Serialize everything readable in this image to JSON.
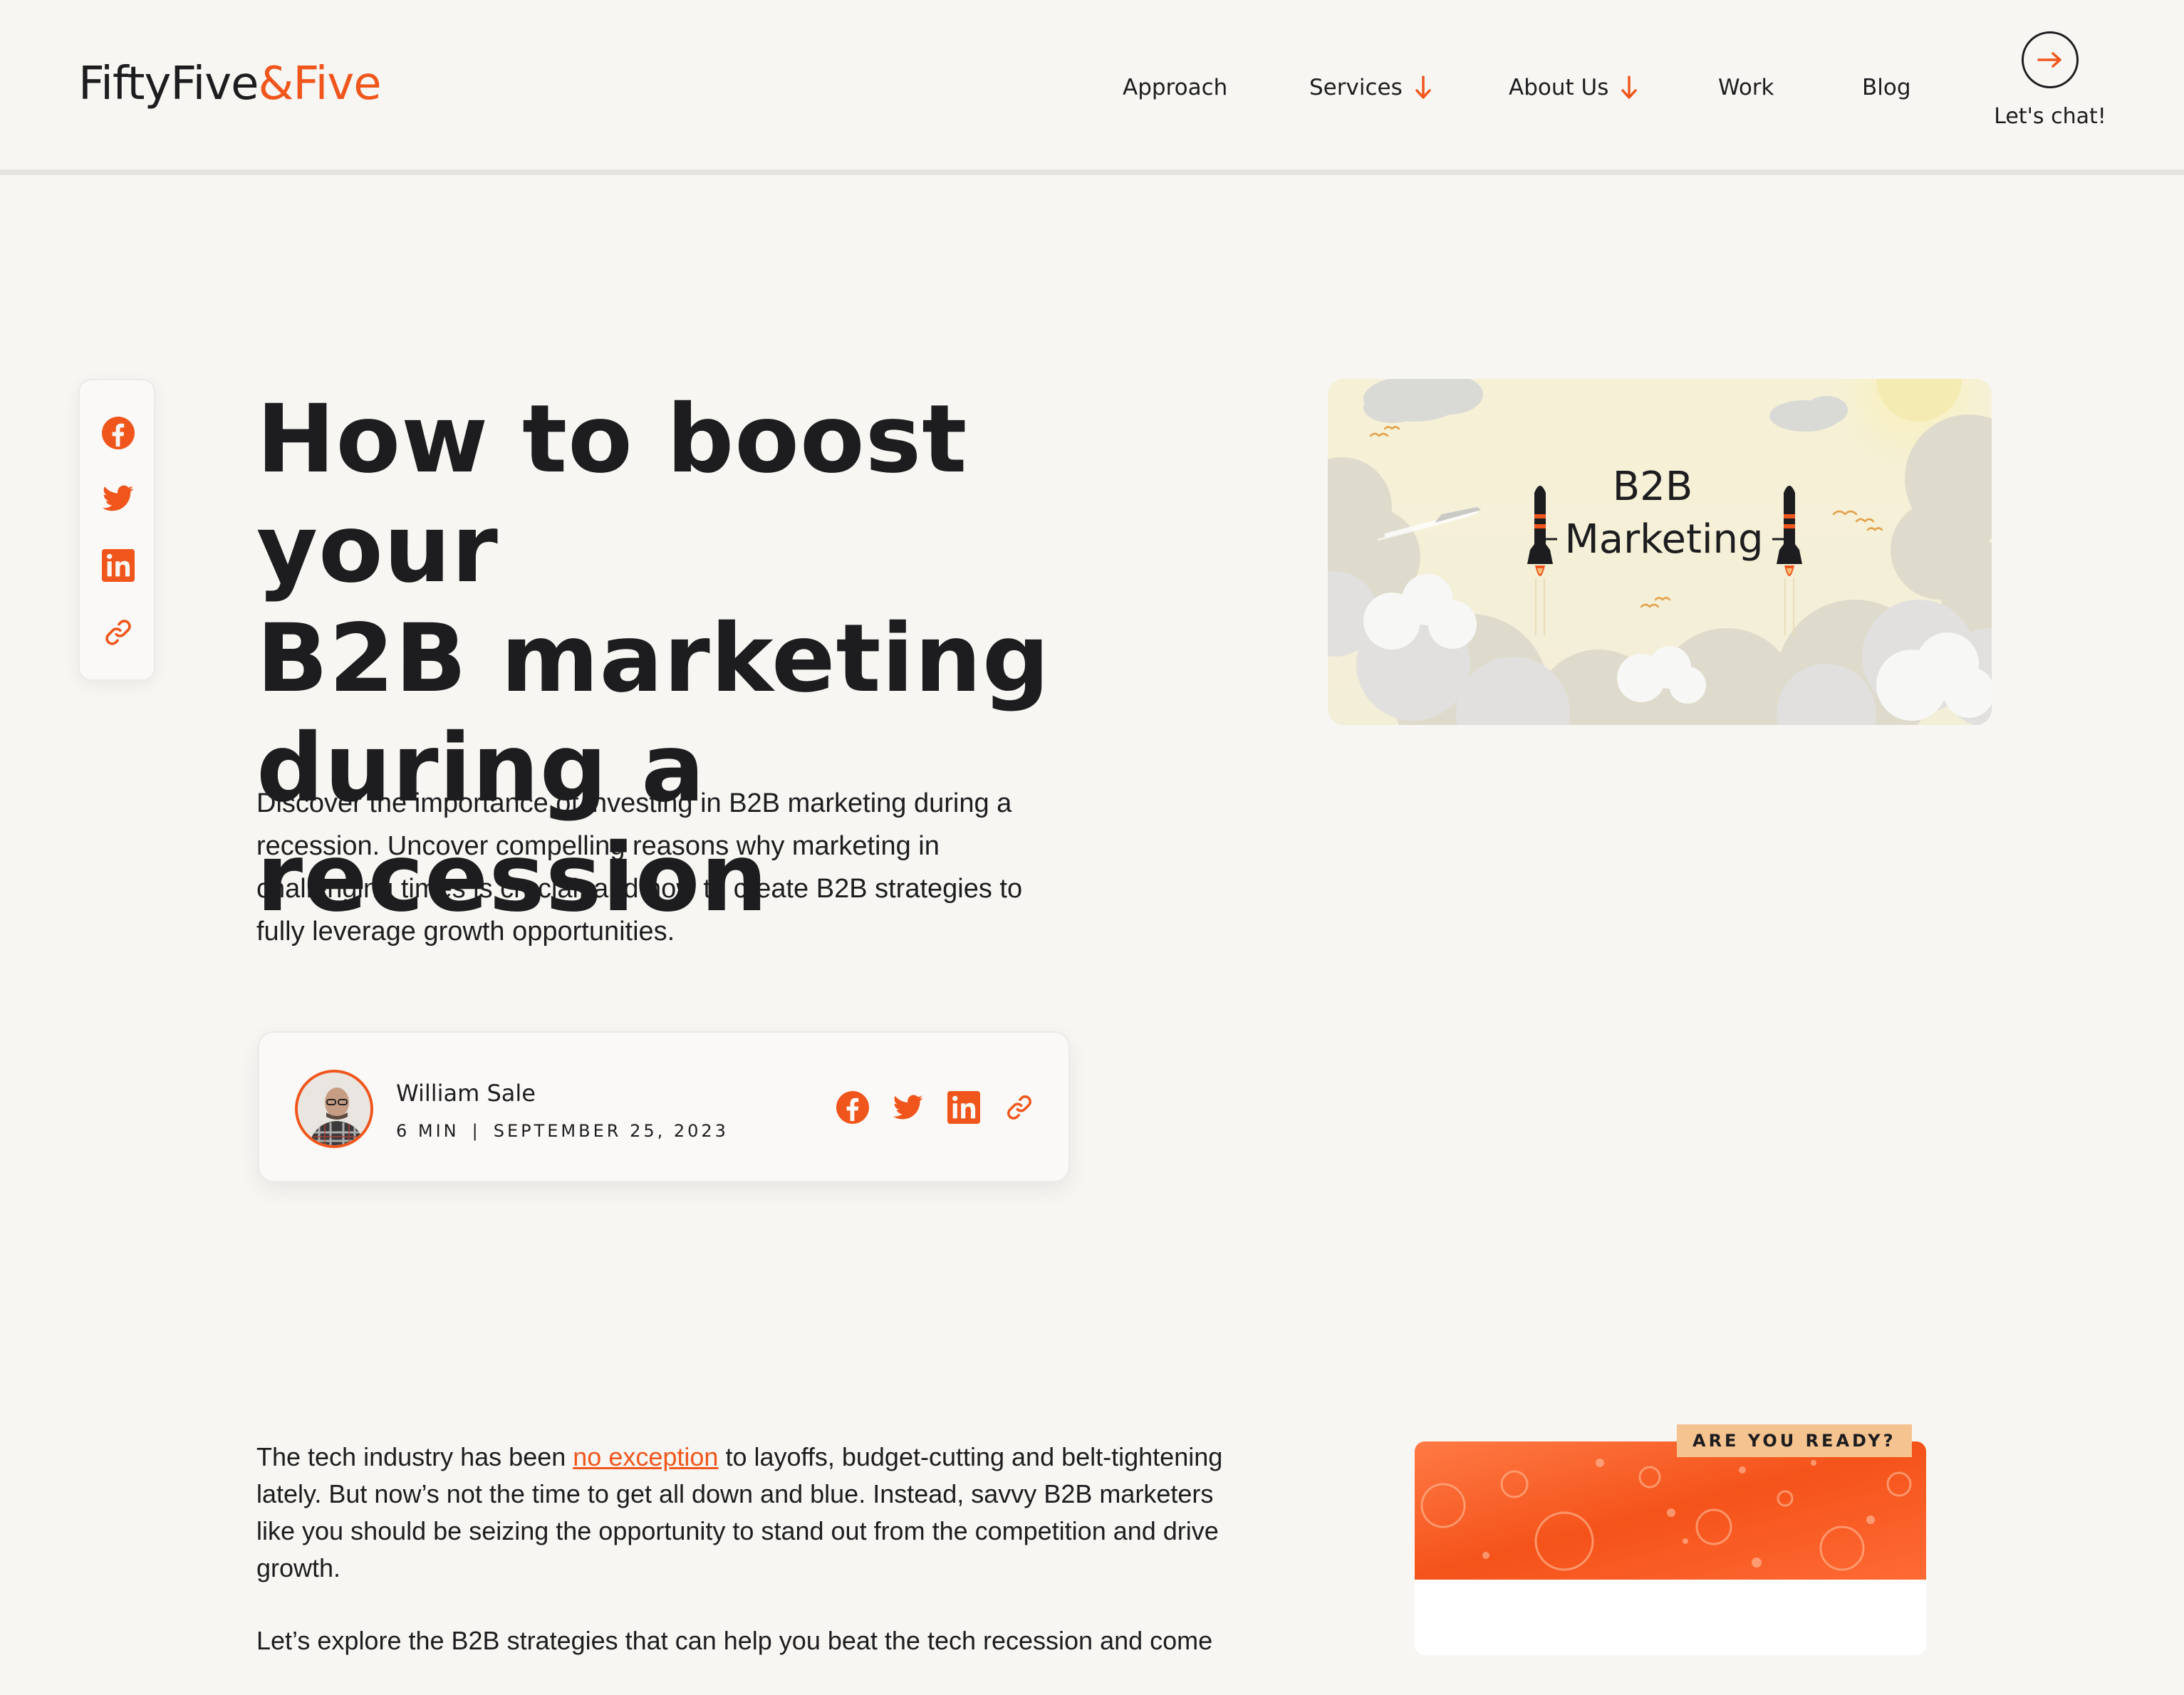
{
  "header": {
    "logo_part1": "FiftyFive",
    "logo_part2": "&Five",
    "nav": [
      {
        "label": "Approach",
        "has_dropdown": false
      },
      {
        "label": "Services",
        "has_dropdown": true
      },
      {
        "label": "About Us",
        "has_dropdown": true
      },
      {
        "label": "Work",
        "has_dropdown": false
      },
      {
        "label": "Blog",
        "has_dropdown": false
      }
    ],
    "cta_label": "Let's chat!"
  },
  "share": {
    "icons": [
      "facebook-icon",
      "twitter-icon",
      "linkedin-icon",
      "link-icon"
    ]
  },
  "article": {
    "title_lines": [
      "How to boost your",
      "B2B marketing",
      "during a recession"
    ],
    "lead": "Discover the importance of investing in B2B marketing during a recession. Uncover compelling reasons why marketing in challenging times is crucial, and how to create B2B strategies to fully leverage growth opportunities.",
    "hero_image_text_line1": "B2B",
    "hero_image_text_line2": "Marketing",
    "author": {
      "name": "William Sale",
      "read_time": "6 MIN",
      "separator": "|",
      "date": "SEPTEMBER 25, 2023"
    },
    "body": {
      "p1_before": "The tech industry has been ",
      "p1_link": "no exception",
      "p1_after": " to layoffs, budget-cutting and belt-tightening lately. But now’s not the time to get all down and blue. Instead, savvy B2B marketers like you should be seizing the opportunity to stand out from the competition and drive growth.",
      "p2": "Let’s explore the B2B strategies that can help you beat the tech recession and come"
    }
  },
  "promo": {
    "tag": "ARE YOU READY?"
  },
  "colors": {
    "accent": "#f0561c",
    "background": "#f7f6f3",
    "ink": "#1d1d1f",
    "promo_tag": "#f5c38f"
  }
}
